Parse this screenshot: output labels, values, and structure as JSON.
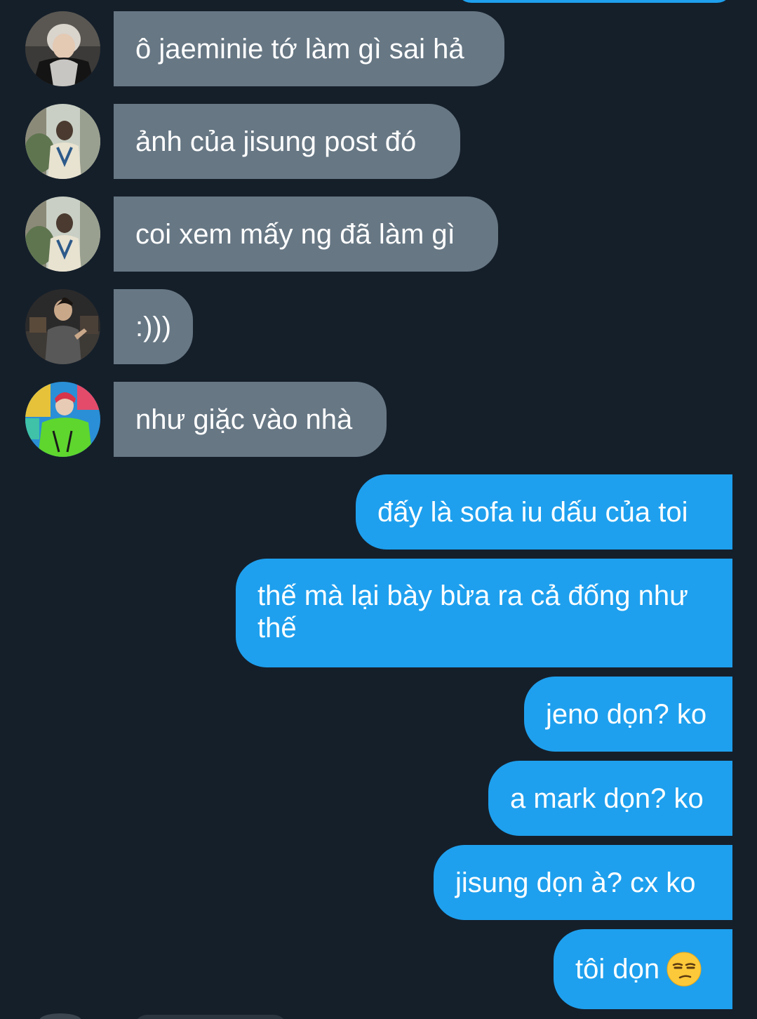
{
  "conversation": {
    "received": [
      {
        "text": "ô jaeminie tớ làm gì sai hả",
        "avatar": "avatar-white-hair-black-jacket"
      },
      {
        "text": "ảnh của jisung post đó",
        "avatar": "avatar-cream-sweater-outdoor"
      },
      {
        "text": "coi xem mấy ng đã làm gì",
        "avatar": "avatar-cream-sweater-outdoor"
      },
      {
        "text": ":)))",
        "avatar": "avatar-dark-room-gesture"
      },
      {
        "text": "như giặc vào nhà",
        "avatar": "avatar-green-jacket-colorful"
      }
    ],
    "sent": [
      {
        "text": "đấy là sofa iu dấu của toi"
      },
      {
        "text": "thế mà lại bày bừa ra cả đống như thế"
      },
      {
        "text": "jeno dọn? ko"
      },
      {
        "text": "a mark dọn? ko"
      },
      {
        "text": "jisung dọn à? cx ko"
      },
      {
        "text": "tôi dọn",
        "emoji": "unamused-face-emoji"
      }
    ]
  },
  "colors": {
    "background": "#151f2a",
    "received_bubble": "#677784",
    "sent_bubble": "#1ea0ee",
    "text": "#ffffff"
  }
}
